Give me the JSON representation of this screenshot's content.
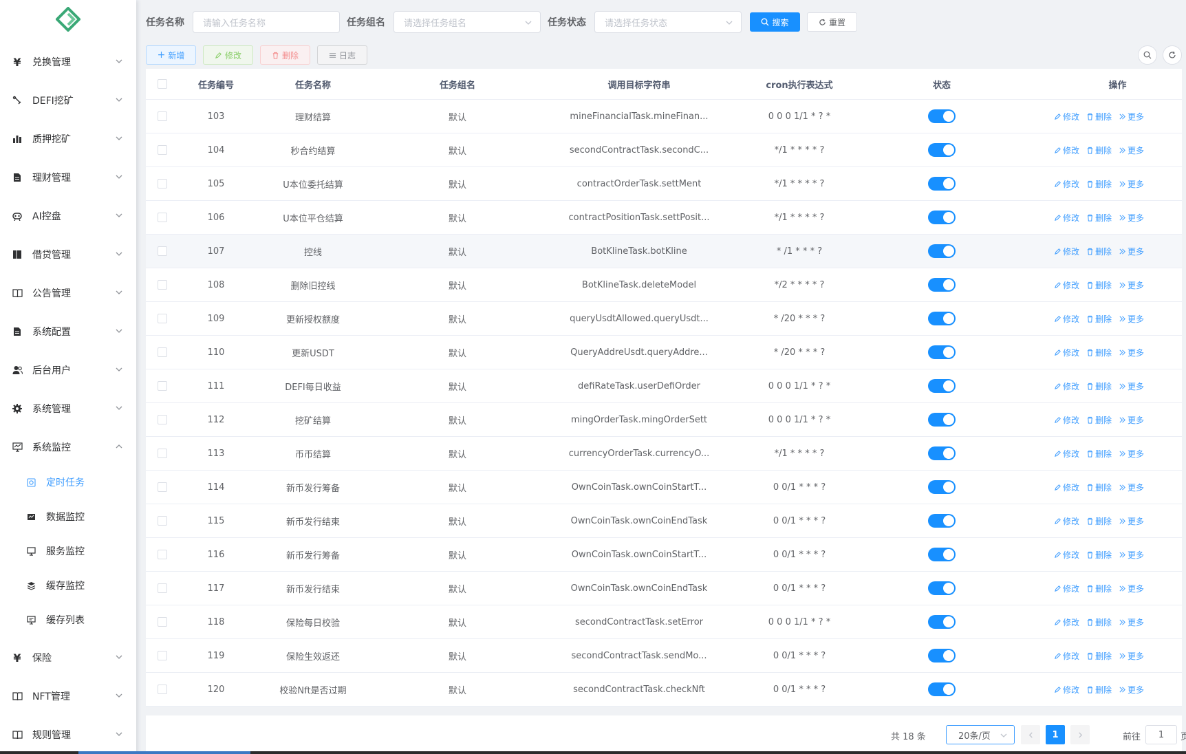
{
  "sidebar": {
    "menu": [
      {
        "label": "兑换管理",
        "icon": "yen-icon",
        "expanded": false
      },
      {
        "label": "DEFI挖矿",
        "icon": "shovel-icon",
        "expanded": false
      },
      {
        "label": "质押挖矿",
        "icon": "bar-chart-icon",
        "expanded": false
      },
      {
        "label": "理财管理",
        "icon": "document-icon",
        "expanded": false
      },
      {
        "label": "AI控盘",
        "icon": "robot-icon",
        "expanded": false
      },
      {
        "label": "借贷管理",
        "icon": "ledger-icon",
        "expanded": false
      },
      {
        "label": "公告管理",
        "icon": "book-icon",
        "expanded": false
      },
      {
        "label": "系统配置",
        "icon": "document-icon",
        "expanded": false
      },
      {
        "label": "后台用户",
        "icon": "users-icon",
        "expanded": false
      },
      {
        "label": "系统管理",
        "icon": "gear-icon",
        "expanded": false
      },
      {
        "label": "系统监控",
        "icon": "monitor-icon",
        "expanded": true
      },
      {
        "label": "保险",
        "icon": "yen-icon",
        "expanded": false
      },
      {
        "label": "NFT管理",
        "icon": "book-icon",
        "expanded": false
      },
      {
        "label": "规则管理",
        "icon": "book-icon",
        "expanded": false
      }
    ],
    "submenu": [
      {
        "label": "定时任务",
        "active": true
      },
      {
        "label": "数据监控",
        "active": false
      },
      {
        "label": "服务监控",
        "active": false
      },
      {
        "label": "缓存监控",
        "active": false
      },
      {
        "label": "缓存列表",
        "active": false
      }
    ]
  },
  "filters": {
    "name_label": "任务名称",
    "name_placeholder": "请输入任务名称",
    "group_label": "任务组名",
    "group_placeholder": "请选择任务组名",
    "status_label": "任务状态",
    "status_placeholder": "请选择任务状态",
    "search_label": "搜索",
    "reset_label": "重置"
  },
  "toolbar": {
    "add_label": "新增",
    "edit_label": "修改",
    "delete_label": "删除",
    "log_label": "日志"
  },
  "table": {
    "headers": {
      "id": "任务编号",
      "name": "任务名称",
      "group": "任务组名",
      "target": "调用目标字符串",
      "cron": "cron执行表达式",
      "status": "状态",
      "ops": "操作"
    },
    "op_labels": {
      "edit": "修改",
      "delete": "删除",
      "more": "更多"
    },
    "rows": [
      {
        "id": "103",
        "name": "理财结算",
        "group": "默认",
        "target": "mineFinancialTask.mineFinan...",
        "cron": "0 0 0 1/1 * ? *",
        "enabled": true
      },
      {
        "id": "104",
        "name": "秒合约结算",
        "group": "默认",
        "target": "secondContractTask.secondC...",
        "cron": "*/1 * * * * ?",
        "enabled": true
      },
      {
        "id": "105",
        "name": "U本位委托结算",
        "group": "默认",
        "target": "contractOrderTask.settMent",
        "cron": "*/1 * * * * ?",
        "enabled": true
      },
      {
        "id": "106",
        "name": "U本位平仓结算",
        "group": "默认",
        "target": "contractPositionTask.settPosit...",
        "cron": "*/1 * * * * ?",
        "enabled": true
      },
      {
        "id": "107",
        "name": "控线",
        "group": "默认",
        "target": "BotKlineTask.botKline",
        "cron": "* /1 * * * ?",
        "enabled": true
      },
      {
        "id": "108",
        "name": "删除旧控线",
        "group": "默认",
        "target": "BotKlineTask.deleteModel",
        "cron": "*/2 * * * * ?",
        "enabled": true
      },
      {
        "id": "109",
        "name": "更新授权额度",
        "group": "默认",
        "target": "queryUsdtAllowed.queryUsdt...",
        "cron": "* /20 * * * ?",
        "enabled": true
      },
      {
        "id": "110",
        "name": "更新USDT",
        "group": "默认",
        "target": "QueryAddreUsdt.queryAddre...",
        "cron": "* /20 * * * ?",
        "enabled": true
      },
      {
        "id": "111",
        "name": "DEFI每日收益",
        "group": "默认",
        "target": "defiRateTask.userDefiOrder",
        "cron": "0 0 0 1/1 * ? *",
        "enabled": true
      },
      {
        "id": "112",
        "name": "挖矿结算",
        "group": "默认",
        "target": "mingOrderTask.mingOrderSett",
        "cron": "0 0 0 1/1 * ? *",
        "enabled": true
      },
      {
        "id": "113",
        "name": "币币结算",
        "group": "默认",
        "target": "currencyOrderTask.currencyO...",
        "cron": "*/1 * * * * ?",
        "enabled": true
      },
      {
        "id": "114",
        "name": "新币发行筹备",
        "group": "默认",
        "target": "OwnCoinTask.ownCoinStartT...",
        "cron": "0 0/1 * * * ?",
        "enabled": true
      },
      {
        "id": "115",
        "name": "新币发行结束",
        "group": "默认",
        "target": "OwnCoinTask.ownCoinEndTask",
        "cron": "0 0/1 * * * ?",
        "enabled": true
      },
      {
        "id": "116",
        "name": "新币发行筹备",
        "group": "默认",
        "target": "OwnCoinTask.ownCoinStartT...",
        "cron": "0 0/1 * * * ?",
        "enabled": true
      },
      {
        "id": "117",
        "name": "新币发行结束",
        "group": "默认",
        "target": "OwnCoinTask.ownCoinEndTask",
        "cron": "0 0/1 * * * ?",
        "enabled": true
      },
      {
        "id": "118",
        "name": "保险每日校验",
        "group": "默认",
        "target": "secondContractTask.setError",
        "cron": "0 0 0 1/1 * ? *",
        "enabled": true
      },
      {
        "id": "119",
        "name": "保险生效返还",
        "group": "默认",
        "target": "secondContractTask.sendMo...",
        "cron": "0 0/1 * * * ?",
        "enabled": true
      },
      {
        "id": "120",
        "name": "校验Nft是否过期",
        "group": "默认",
        "target": "secondContractTask.checkNft",
        "cron": "0 0/1 * * * ?",
        "enabled": true
      }
    ]
  },
  "pagination": {
    "total_text": "共 18 条",
    "page_size": "20条/页",
    "current_page": "1",
    "goto_label": "前往",
    "goto_value": "1",
    "page_suffix": "页"
  },
  "colors": {
    "primary": "#1890ff",
    "link": "#409eff",
    "logo_green": "#3aa876"
  }
}
